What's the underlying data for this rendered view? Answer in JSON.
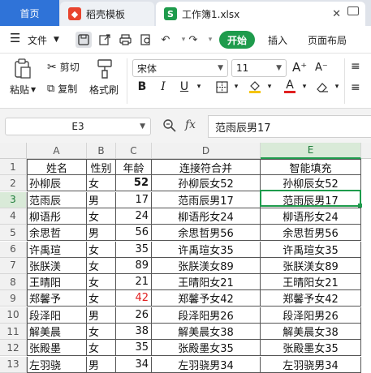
{
  "tabs": {
    "home": "首页",
    "template": "稻壳模板",
    "workbook": "工作簿1.xlsx",
    "close_glyph": "✕"
  },
  "menu": {
    "file": "文件",
    "start": "开始",
    "insert": "插入",
    "page_layout": "页面布局"
  },
  "ribbon": {
    "paste": "粘贴",
    "cut": "剪切",
    "copy": "复制",
    "format_painter": "格式刷",
    "font_name": "宋体",
    "font_size": "11",
    "bold": "B",
    "italic": "I",
    "underline": "U",
    "increase_font": "A⁺",
    "decrease_font": "A⁻",
    "font_color": "A"
  },
  "formula_bar": {
    "cell_ref": "E3",
    "fx": "fx",
    "content": "范雨辰男17"
  },
  "columns": [
    "A",
    "B",
    "C",
    "D",
    "E"
  ],
  "selected_column": "E",
  "selected_row": "3",
  "rows": [
    {
      "n": "1",
      "a": "姓名",
      "b": "性别",
      "c": "年龄",
      "d": "连接符合并",
      "e": "智能填充"
    },
    {
      "n": "2",
      "a": "孙柳辰",
      "b": "女",
      "c": "52",
      "d": "孙柳辰女52",
      "e": "孙柳辰女52"
    },
    {
      "n": "3",
      "a": "范雨辰",
      "b": "男",
      "c": "17",
      "d": "范雨辰男17",
      "e": "范雨辰男17"
    },
    {
      "n": "4",
      "a": "柳语彤",
      "b": "女",
      "c": "24",
      "d": "柳语彤女24",
      "e": "柳语彤女24"
    },
    {
      "n": "5",
      "a": "余思哲",
      "b": "男",
      "c": "56",
      "d": "余思哲男56",
      "e": "余思哲男56"
    },
    {
      "n": "6",
      "a": "许禹瑄",
      "b": "女",
      "c": "35",
      "d": "许禹瑄女35",
      "e": "许禹瑄女35"
    },
    {
      "n": "7",
      "a": "张朕渼",
      "b": "女",
      "c": "89",
      "d": "张朕渼女89",
      "e": "张朕渼女89"
    },
    {
      "n": "8",
      "a": "王晴阳",
      "b": "女",
      "c": "21",
      "d": "王晴阳女21",
      "e": "王晴阳女21"
    },
    {
      "n": "9",
      "a": "郑馨予",
      "b": "女",
      "c": "42",
      "d": "郑馨予女42",
      "e": "郑馨予女42"
    },
    {
      "n": "10",
      "a": "段泽阳",
      "b": "男",
      "c": "26",
      "d": "段泽阳男26",
      "e": "段泽阳男26"
    },
    {
      "n": "11",
      "a": "解美晨",
      "b": "女",
      "c": "38",
      "d": "解美晨女38",
      "e": "解美晨女38"
    },
    {
      "n": "12",
      "a": "张殿墨",
      "b": "女",
      "c": "35",
      "d": "张殿墨女35",
      "e": "张殿墨女35"
    },
    {
      "n": "13",
      "a": "左羽骁",
      "b": "男",
      "c": "34",
      "d": "左羽骁男34",
      "e": "左羽骁男34"
    }
  ],
  "colors": {
    "accent": "#1e9b4c",
    "home_tab": "#2f73d8",
    "red_value": "#e02020"
  }
}
